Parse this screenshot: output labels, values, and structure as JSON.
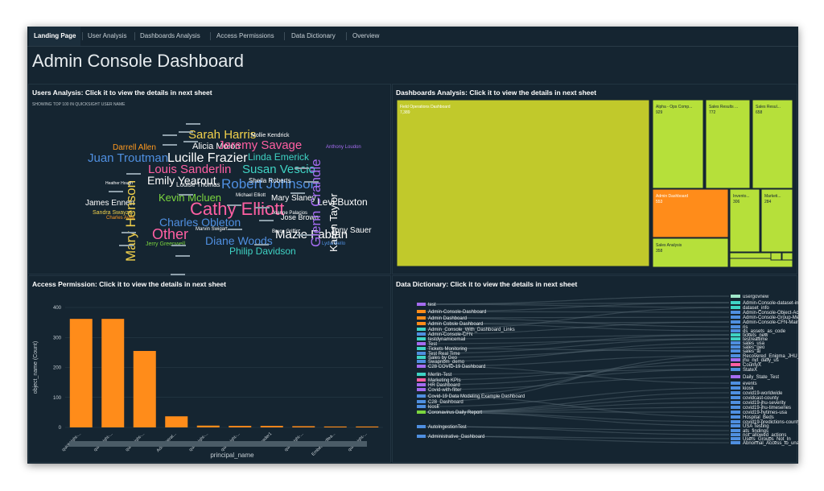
{
  "tabs": [
    {
      "label": "Landing Page"
    },
    {
      "label": "User Analysis"
    },
    {
      "label": "Dashboards Analysis"
    },
    {
      "label": "Access Permissions"
    },
    {
      "label": "Data Dictionary"
    },
    {
      "label": "Overview"
    }
  ],
  "page_title": "Admin Console Dashboard",
  "users_panel": {
    "title": "Users Analysis: Click it to view the details in next sheet",
    "subtitle": "SHOWING TOP 100 IN QUICKSIGHT USER NAME",
    "words": [
      {
        "text": "Sarah Harris",
        "color": "#f2d14b"
      },
      {
        "text": "Mollie Kendrick",
        "color": "#ffffff"
      },
      {
        "text": "Alicia Molon",
        "color": "#ffffff"
      },
      {
        "text": "Jeremy Savage",
        "color": "#ff5fa2"
      },
      {
        "text": "Darrell Allen",
        "color": "#ff9a1f"
      },
      {
        "text": "Juan Troutman",
        "color": "#4f8fe0"
      },
      {
        "text": "Lucille Frazier",
        "color": "#ffffff"
      },
      {
        "text": "Linda Emerick",
        "color": "#3fd3c4"
      },
      {
        "text": "Louis Sanderlin",
        "color": "#ff5fa2"
      },
      {
        "text": "Emily Yearout",
        "color": "#ffffff"
      },
      {
        "text": "Susan Vescio",
        "color": "#3fd3c4"
      },
      {
        "text": "Robert Johnson",
        "color": "#4f8fe0"
      },
      {
        "text": "Kevin Mcluen",
        "color": "#7bd63f"
      },
      {
        "text": "Mary Slaney",
        "color": "#ffffff"
      },
      {
        "text": "Levi Buxton",
        "color": "#ffffff"
      },
      {
        "text": "James Ennen",
        "color": "#ffffff"
      },
      {
        "text": "Cathy Elliott",
        "color": "#ff5fa2"
      },
      {
        "text": "Charles Obleton",
        "color": "#4f8fe0"
      },
      {
        "text": "Jose Brown",
        "color": "#ffffff"
      },
      {
        "text": "Tony Sauer",
        "color": "#ffffff"
      },
      {
        "text": "Other",
        "color": "#ff5fa2"
      },
      {
        "text": "Diane Woods",
        "color": "#4f8fe0"
      },
      {
        "text": "Mazie Fabian",
        "color": "#ffffff"
      },
      {
        "text": "Philip Davidson",
        "color": "#3fd3c4"
      },
      {
        "text": "Sandra Swayzer",
        "color": "#f2d14b"
      },
      {
        "text": "Mary Henson",
        "color": "#f2d14b"
      },
      {
        "text": "Glenn Crandle",
        "color": "#a56cf0"
      },
      {
        "text": "Karen Taylor",
        "color": "#ffffff"
      },
      {
        "text": "Anthony Loudon",
        "color": "#a56cf0"
      },
      {
        "text": "Jerry Greenwell",
        "color": "#7bd63f"
      },
      {
        "text": "Lydia Bello",
        "color": "#4f8fe0"
      },
      {
        "text": "Louise Thomas",
        "color": "#ffffff"
      },
      {
        "text": "Sheila Roberts",
        "color": "#ffffff"
      },
      {
        "text": "Michael Elliott",
        "color": "#ffffff"
      },
      {
        "text": "Joanne Palacios",
        "color": "#ffffff"
      },
      {
        "text": "Marvin Swigart",
        "color": "#ffffff"
      },
      {
        "text": "Bruce Griffin",
        "color": "#ffffff"
      },
      {
        "text": "Charles Avila",
        "color": "#ff9a1f"
      },
      {
        "text": "Heather Hough",
        "color": "#ffffff"
      }
    ]
  },
  "dash_panel": {
    "title": "Dashboards Analysis: Click it to view the details in next sheet",
    "tiles": [
      {
        "name": "Field Operations Dashboard",
        "value": "7,389",
        "color": "#c1c92b"
      },
      {
        "name": "Alpha - Ops Comp...",
        "value": "929",
        "color": "#b6e03a"
      },
      {
        "name": "Sales Results ...",
        "value": "772",
        "color": "#b6e03a"
      },
      {
        "name": "Sales Resul...",
        "value": "658",
        "color": "#b6e03a"
      },
      {
        "name": "Admin Dashboard",
        "value": "553",
        "color": "#ff8c1a"
      },
      {
        "name": "Invento...",
        "value": "306",
        "color": "#b6e03a"
      },
      {
        "name": "Marketi...",
        "value": "284",
        "color": "#b6e03a"
      },
      {
        "name": "Sales Analysis",
        "value": "358",
        "color": "#b6e03a"
      },
      {
        "name": "",
        "value": "",
        "color": "#b6e03a"
      },
      {
        "name": "",
        "value": "",
        "color": "#b6e03a"
      },
      {
        "name": "",
        "value": "",
        "color": "#b6e03a"
      },
      {
        "name": "",
        "value": "",
        "color": "#b6e03a"
      }
    ]
  },
  "access_panel": {
    "title": "Access Permission: Click it to view the details in next sheet"
  },
  "chart_data": {
    "type": "bar",
    "title": "",
    "xlabel": "principal_name",
    "ylabel": "object_name (Count)",
    "ylim": [
      0,
      400
    ],
    "yticks": [
      0,
      100,
      200,
      300,
      400
    ],
    "bar_color": "#ff8c1a",
    "grid": true,
    "categories": [
      "quicksight-...",
      "quicksight-...",
      "quicksight-...",
      "Administrat...",
      "quicksight-...",
      "quicksight-...",
      "reader1",
      "quicksight-...",
      "Embeddedfea...",
      "quicksight-..."
    ],
    "values": [
      362,
      362,
      255,
      37,
      6,
      5,
      5,
      4,
      3,
      3
    ]
  },
  "dict_panel": {
    "title": "Data Dictionary: Click it to view the details in next sheet",
    "left_items": [
      {
        "label": "test",
        "color": "#a56cf0"
      },
      {
        "label": "Admin-Console-Dashboard",
        "color": "#ff8c1a"
      },
      {
        "label": "Admin Dashboard",
        "color": "#ff8c1a"
      },
      {
        "label": "Admin Cobsle Dashboard",
        "color": "#ff8c1a"
      },
      {
        "label": "Admin_Console_With_Dashboard_Links",
        "color": "#3fd3c4"
      },
      {
        "label": "Admin-Console-CFN",
        "color": "#4f8fe0"
      },
      {
        "label": "testdynamicemail",
        "color": "#3fd3c4"
      },
      {
        "label": "Test",
        "color": "#a56cf0"
      },
      {
        "label": "Tickets Monitoring",
        "color": "#3fd3c4"
      },
      {
        "label": "Test Real Time",
        "color": "#4f8fe0"
      },
      {
        "label": "Sales by Geo",
        "color": "#3fd3c4"
      },
      {
        "label": "Swapnbm_demo",
        "color": "#4f8fe0"
      },
      {
        "label": "C28 COVID-19 Dashboard",
        "color": "#a56cf0"
      },
      {
        "label": "Merlin-Test",
        "color": "#3fd3c4"
      },
      {
        "label": "Marketing KPIs",
        "color": "#ff5fa2"
      },
      {
        "label": "HR Dashboard",
        "color": "#a56cf0"
      },
      {
        "label": "Covid-with-filter",
        "color": "#a56cf0"
      },
      {
        "label": "Covid-19 Data Modeling Example Dashboard",
        "color": "#4f8fe0"
      },
      {
        "label": "C28_Dashboard",
        "color": "#4f8fe0"
      },
      {
        "label": "kiosk",
        "color": "#4f8fe0"
      },
      {
        "label": "Coronavirus Daily Report",
        "color": "#7bd63f"
      },
      {
        "label": "AutoIngestionTest",
        "color": "#4f8fe0"
      },
      {
        "label": "Administrative_Dashboard",
        "color": "#4f8fe0"
      }
    ],
    "right_items": [
      {
        "label": "usergovnew",
        "color": "#9fe6c9"
      },
      {
        "label": "Admin-Console-dataset-info",
        "color": "#3fd3c4"
      },
      {
        "label": "dataset_info",
        "color": "#3fd3c4"
      },
      {
        "label": "Admin-Console-Object-Access",
        "color": "#4f8fe0"
      },
      {
        "label": "Admin-Console-Group-Membersh",
        "color": "#4f8fe0"
      },
      {
        "label": "Admin-Console-CFN-Main",
        "color": "#4f8fe0"
      },
      {
        "label": "ris",
        "color": "#4f8fe0"
      },
      {
        "label": "ds_assets_as_code",
        "color": "#4f8fe0"
      },
      {
        "label": "tickets_new",
        "color": "#3fd3c4"
      },
      {
        "label": "testrealtime",
        "color": "#3fd3c4"
      },
      {
        "label": "sales_usa",
        "color": "#4f8fe0"
      },
      {
        "label": "sales_geo",
        "color": "#4f8fe0"
      },
      {
        "label": "sales_al",
        "color": "#4f8fe0"
      },
      {
        "label": "Recovered_Enigma_JHU_Daily",
        "color": "#4f8fe0"
      },
      {
        "label": "jhu_nyt_daily_us",
        "color": "#a56cf0"
      },
      {
        "label": "CountyX",
        "color": "#ff5fa2"
      },
      {
        "label": "StateX",
        "color": "#4f8fe0"
      },
      {
        "label": "Daily_State_Test",
        "color": "#a56cf0"
      },
      {
        "label": "events",
        "color": "#4f8fe0"
      },
      {
        "label": "kiosk",
        "color": "#4f8fe0"
      },
      {
        "label": "covid19-worldwide",
        "color": "#4f8fe0"
      },
      {
        "label": "covidcast-county",
        "color": "#4f8fe0"
      },
      {
        "label": "covid19-jhu-severity",
        "color": "#4f8fe0"
      },
      {
        "label": "covid19-jhu-timeseries",
        "color": "#4f8fe0"
      },
      {
        "label": "covid19-hytimes-usa",
        "color": "#4f8fe0"
      },
      {
        "label": "Hospital_Beds",
        "color": "#4f8fe0"
      },
      {
        "label": "covid19-predictions-county",
        "color": "#4f8fe0"
      },
      {
        "label": "USA Testing",
        "color": "#4f8fe0"
      },
      {
        "label": "ats_findings",
        "color": "#4f8fe0"
      },
      {
        "label": "not_allowed_actions",
        "color": "#4f8fe0"
      },
      {
        "label": "Users_Groups_Not_In",
        "color": "#4f8fe0"
      },
      {
        "label": "Abnormal_Access_to_unassigned_",
        "color": "#4f8fe0"
      }
    ]
  }
}
